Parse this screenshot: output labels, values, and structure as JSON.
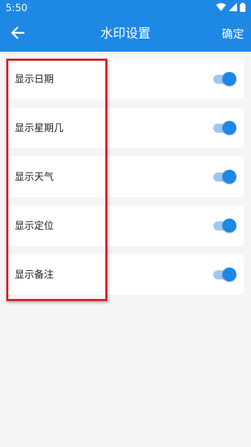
{
  "status_bar": {
    "time": "5:50",
    "icons": [
      "wifi-icon",
      "cell-signal-icon",
      "battery-icon"
    ]
  },
  "app_bar": {
    "title": "水印设置",
    "back_icon": "arrow-left-icon",
    "confirm_label": "确定"
  },
  "colors": {
    "primary": "#1e88e5",
    "toggle_track": "#9cc8f3",
    "background": "#f5f5f7",
    "highlight": "#d22424"
  },
  "settings": [
    {
      "label": "显示日期",
      "enabled": true
    },
    {
      "label": "显示星期几",
      "enabled": true
    },
    {
      "label": "显示天气",
      "enabled": true
    },
    {
      "label": "显示定位",
      "enabled": true
    },
    {
      "label": "显示备注",
      "enabled": true
    }
  ]
}
